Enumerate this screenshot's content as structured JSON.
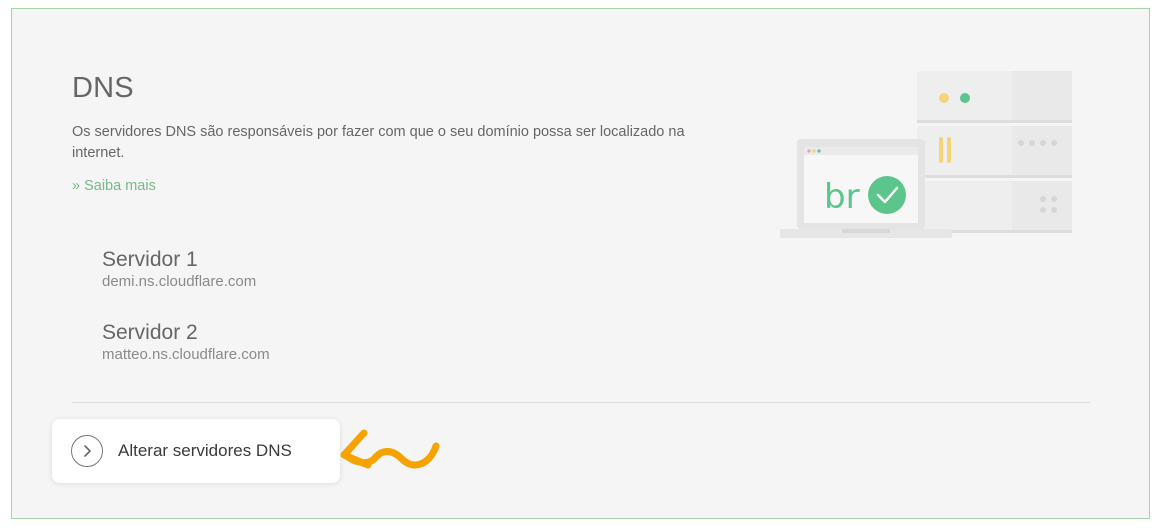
{
  "section": {
    "title": "DNS",
    "description": "Os servidores DNS são responsáveis por fazer com que o seu domínio possa ser localizado na internet.",
    "learn_more": "» Saiba mais"
  },
  "servers": [
    {
      "label": "Servidor 1",
      "host": "demi.ns.cloudflare.com"
    },
    {
      "label": "Servidor 2",
      "host": "matteo.ns.cloudflare.com"
    }
  ],
  "action": {
    "label": "Alterar servidores DNS"
  },
  "colors": {
    "accent_green": "#6cc38a",
    "link_green": "#77b988",
    "highlight_arrow": "#f5a300",
    "panel_border": "#a9d3a9"
  },
  "icons": {
    "action_icon": "chevron-right-icon",
    "illustration": "server-laptop-illustration",
    "highlight": "curved-arrow-icon"
  },
  "illustration": {
    "brand_text": "br"
  }
}
